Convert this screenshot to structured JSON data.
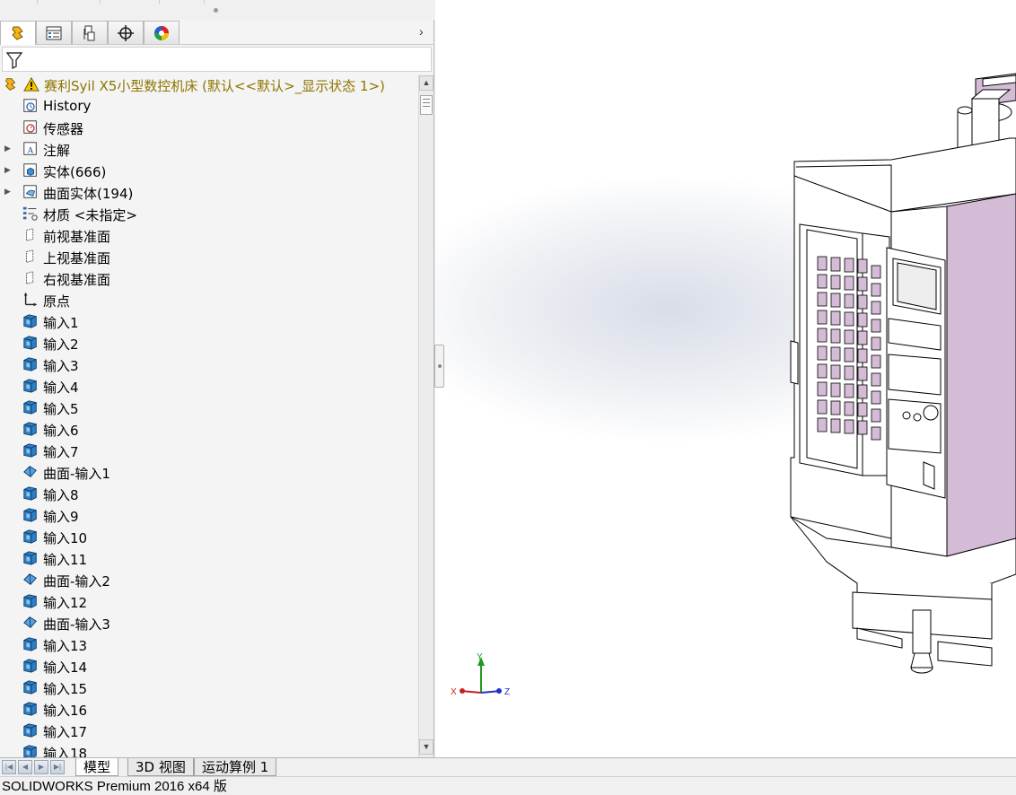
{
  "manager_tabs": [
    {
      "name": "featuremanager-tab",
      "icon": "featuremanager-icon",
      "active": true
    },
    {
      "name": "propertymanager-tab",
      "icon": "propertymanager-icon",
      "active": false
    },
    {
      "name": "configurationmanager-tab",
      "icon": "configurationmanager-icon",
      "active": false
    },
    {
      "name": "dimxpertmanager-tab",
      "icon": "dimxpert-crosshair-icon",
      "active": false
    },
    {
      "name": "displaymanager-tab",
      "icon": "display-color-wheel-icon",
      "active": false
    }
  ],
  "tab_arrow": "›",
  "tree": {
    "root": "赛利Syil X5小型数控机床 (默认<<默认>_显示状态 1>)",
    "items": [
      {
        "label": "History",
        "icon": "history-icon",
        "expander": false
      },
      {
        "label": "传感器",
        "icon": "sensor-icon",
        "expander": false
      },
      {
        "label": "注解",
        "icon": "annotation-icon",
        "expander": true
      },
      {
        "label": "实体(666)",
        "icon": "solid-bodies-folder-icon",
        "expander": true
      },
      {
        "label": "曲面实体(194)",
        "icon": "surface-bodies-folder-icon",
        "expander": true
      },
      {
        "label": "材质 <未指定>",
        "icon": "material-icon",
        "expander": false
      },
      {
        "label": "前视基准面",
        "icon": "plane-icon",
        "expander": false
      },
      {
        "label": "上视基准面",
        "icon": "plane-icon",
        "expander": false
      },
      {
        "label": "右视基准面",
        "icon": "plane-icon",
        "expander": false
      },
      {
        "label": "原点",
        "icon": "origin-icon",
        "expander": false
      },
      {
        "label": "输入1",
        "icon": "import-feature-icon",
        "expander": false
      },
      {
        "label": "输入2",
        "icon": "import-feature-icon",
        "expander": false
      },
      {
        "label": "输入3",
        "icon": "import-feature-icon",
        "expander": false
      },
      {
        "label": "输入4",
        "icon": "import-feature-icon",
        "expander": false
      },
      {
        "label": "输入5",
        "icon": "import-feature-icon",
        "expander": false
      },
      {
        "label": "输入6",
        "icon": "import-feature-icon",
        "expander": false
      },
      {
        "label": "输入7",
        "icon": "import-feature-icon",
        "expander": false
      },
      {
        "label": "曲面-输入1",
        "icon": "surface-import-icon",
        "expander": false
      },
      {
        "label": "输入8",
        "icon": "import-feature-icon",
        "expander": false
      },
      {
        "label": "输入9",
        "icon": "import-feature-icon",
        "expander": false
      },
      {
        "label": "输入10",
        "icon": "import-feature-icon",
        "expander": false
      },
      {
        "label": "输入11",
        "icon": "import-feature-icon",
        "expander": false
      },
      {
        "label": "曲面-输入2",
        "icon": "surface-import-icon",
        "expander": false
      },
      {
        "label": "输入12",
        "icon": "import-feature-icon",
        "expander": false
      },
      {
        "label": "曲面-输入3",
        "icon": "surface-import-icon",
        "expander": false
      },
      {
        "label": "输入13",
        "icon": "import-feature-icon",
        "expander": false
      },
      {
        "label": "输入14",
        "icon": "import-feature-icon",
        "expander": false
      },
      {
        "label": "输入15",
        "icon": "import-feature-icon",
        "expander": false
      },
      {
        "label": "输入16",
        "icon": "import-feature-icon",
        "expander": false
      },
      {
        "label": "输入17",
        "icon": "import-feature-icon",
        "expander": false
      },
      {
        "label": "输入18",
        "icon": "import-feature-icon",
        "expander": false
      }
    ]
  },
  "bottom_tabs": [
    {
      "label": "模型",
      "active": true
    },
    {
      "label": "3D 视图",
      "active": false
    },
    {
      "label": "运动算例 1",
      "active": false
    }
  ],
  "triad": {
    "x": "X",
    "y": "Y",
    "z": "Z"
  },
  "status_bar": "SOLIDWORKS Premium 2016 x64 版",
  "colors": {
    "model_face": "#d4bcd6",
    "model_edge": "#000000",
    "root_text": "#8c7600"
  }
}
